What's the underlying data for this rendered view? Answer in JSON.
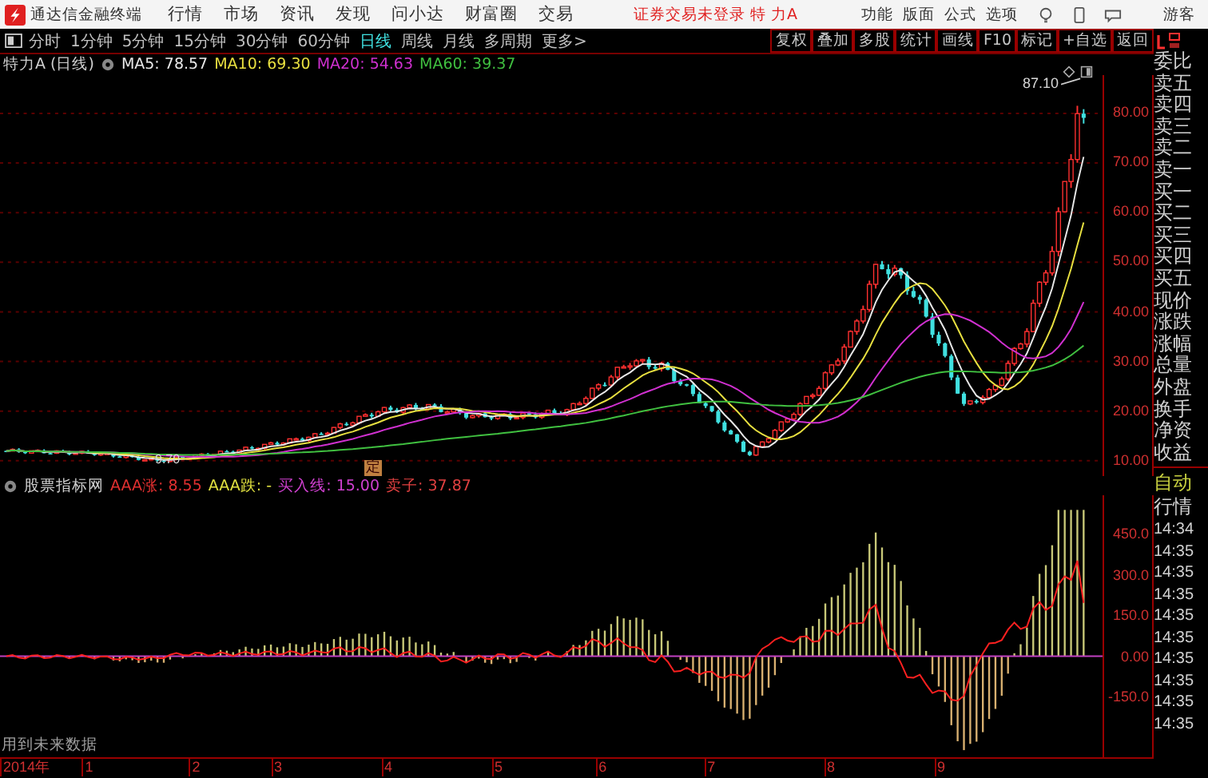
{
  "app": {
    "title": "通达信金融终端",
    "menus": [
      "行情",
      "市场",
      "资讯",
      "发现",
      "问小达",
      "财富圈",
      "交易"
    ],
    "login_notice": "证券交易未登录 特 力A",
    "right_menus": [
      "功能",
      "版面",
      "公式",
      "选项"
    ],
    "user": "游客"
  },
  "periods": [
    {
      "label": "分时",
      "selected": false
    },
    {
      "label": "1分钟",
      "selected": false
    },
    {
      "label": "5分钟",
      "selected": false
    },
    {
      "label": "15分钟",
      "selected": false
    },
    {
      "label": "30分钟",
      "selected": false
    },
    {
      "label": "60分钟",
      "selected": false
    },
    {
      "label": "日线",
      "selected": true
    },
    {
      "label": "周线",
      "selected": false
    },
    {
      "label": "月线",
      "selected": false
    },
    {
      "label": "多周期",
      "selected": false
    },
    {
      "label": "更多>",
      "selected": false
    }
  ],
  "tools": [
    "复权",
    "叠加",
    "多股",
    "统计",
    "画线",
    "F10",
    "标记",
    "+自选",
    "返回"
  ],
  "chart_info": {
    "title": "特力A (日线)",
    "mas": [
      {
        "label": "MA5: 78.57",
        "color": "#e8e8e8"
      },
      {
        "label": "MA10: 69.30",
        "color": "#e8e040"
      },
      {
        "label": "MA20: 54.63",
        "color": "#d030d0"
      },
      {
        "label": "MA60: 39.37",
        "color": "#40c040"
      }
    ]
  },
  "price_chart": {
    "high_label": "87.10",
    "low_label": "9.70",
    "marker": "定",
    "axis": [
      "80.00",
      "70.00",
      "60.00",
      "50.00",
      "40.00",
      "30.00",
      "20.00",
      "10.00"
    ]
  },
  "indicator": {
    "name": "股票指标网",
    "values": [
      {
        "label": "AAA涨: 8.55",
        "color": "#e03030"
      },
      {
        "label": "AAA跌: -",
        "color": "#e0e040"
      },
      {
        "label": "买入线: 15.00",
        "color": "#d040d0"
      },
      {
        "label": "卖子: 37.87",
        "color": "#e04040"
      }
    ],
    "axis": [
      "450.0",
      "300.0",
      "150.0",
      "0.00",
      "-150.0"
    ],
    "note": "用到未来数据"
  },
  "time_axis": [
    "2014年",
    "1",
    "2",
    "3",
    "4",
    "5",
    "6",
    "7",
    "8",
    "9"
  ],
  "quote_panel": {
    "labels": [
      "委比",
      "卖五",
      "卖四",
      "卖三",
      "卖二",
      "卖一",
      "买一",
      "买二",
      "买三",
      "买四",
      "买五",
      "现价",
      "涨跌",
      "涨幅",
      "总量",
      "外盘",
      "换手",
      "净资",
      "收益"
    ],
    "tabs": [
      {
        "label": "自动",
        "selected": true
      },
      {
        "label": "行情",
        "selected": false
      }
    ],
    "times": [
      "14:34",
      "14:35",
      "14:35",
      "14:35",
      "14:35",
      "14:35",
      "14:35",
      "14:35",
      "14:35",
      "14:35"
    ]
  }
}
